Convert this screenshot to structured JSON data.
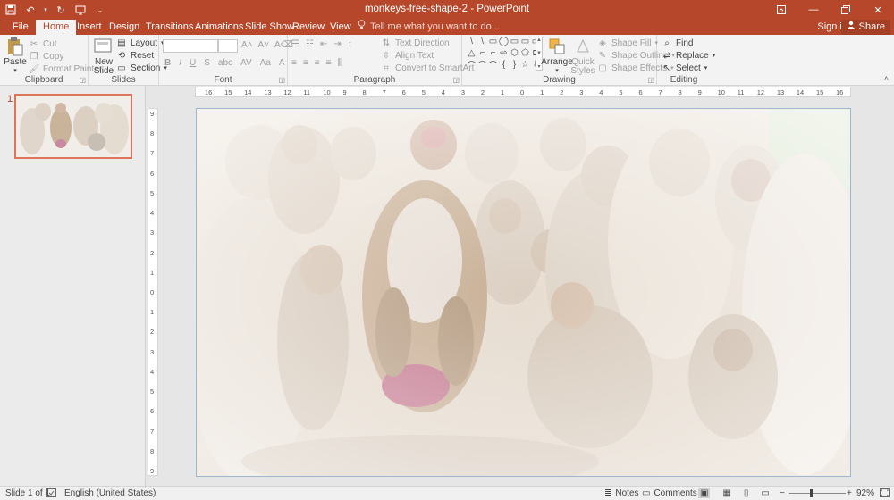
{
  "title_bar": {
    "document_title": "monkeys-free-shape-2 - PowerPoint",
    "qat_icons": [
      "save-icon",
      "undo-icon",
      "redo-icon",
      "start-from-beginning-icon",
      "customize-qat-icon"
    ],
    "window_controls": [
      "ribbon-display-icon",
      "minimize-icon",
      "restore-icon",
      "close-icon"
    ]
  },
  "tabs": [
    {
      "label": "File"
    },
    {
      "label": "Home"
    },
    {
      "label": "Insert"
    },
    {
      "label": "Design"
    },
    {
      "label": "Transitions"
    },
    {
      "label": "Animations"
    },
    {
      "label": "Slide Show"
    },
    {
      "label": "Review"
    },
    {
      "label": "View"
    }
  ],
  "active_tab": "Home",
  "tell_me": "Tell me what you want to do...",
  "sign_in": "Sign in",
  "share": "Share",
  "ribbon": {
    "clipboard": {
      "label": "Clipboard",
      "paste": "Paste",
      "cut": "Cut",
      "copy": "Copy",
      "format_painter": "Format Painter"
    },
    "slides": {
      "label": "Slides",
      "new_slide_line1": "New",
      "new_slide_line2": "Slide",
      "layout": "Layout",
      "reset": "Reset",
      "section": "Section"
    },
    "font": {
      "label": "Font",
      "buttons": [
        "B",
        "I",
        "U",
        "S",
        "abc",
        "AV",
        "Aa",
        "A"
      ]
    },
    "paragraph": {
      "label": "Paragraph",
      "text_direction": "Text Direction",
      "align_text": "Align Text",
      "convert_smartart": "Convert to SmartArt"
    },
    "drawing": {
      "label": "Drawing",
      "arrange": "Arrange",
      "quick_styles_line1": "Quick",
      "quick_styles_line2": "Styles",
      "shape_fill": "Shape Fill",
      "shape_outline": "Shape Outline",
      "shape_effects": "Shape Effects",
      "shapes": [
        "\\",
        "\\",
        "▭",
        "◯",
        "▭",
        "▭",
        "▭",
        "△",
        "⌐",
        "⌐",
        "⇨",
        "⬡",
        "⬠",
        "⊏",
        "⌒",
        "⌒",
        "⌒",
        "{",
        "}",
        "☆",
        "⇩"
      ]
    },
    "editing": {
      "label": "Editing",
      "find": "Find",
      "replace": "Replace",
      "select": "Select"
    }
  },
  "rulers": {
    "horizontal": [
      "16",
      "15",
      "14",
      "13",
      "12",
      "11",
      "10",
      "9",
      "8",
      "7",
      "6",
      "5",
      "4",
      "3",
      "2",
      "1",
      "0",
      "1",
      "2",
      "3",
      "4",
      "5",
      "6",
      "7",
      "8",
      "9",
      "10",
      "11",
      "12",
      "13",
      "14",
      "15",
      "16"
    ],
    "vertical": [
      "9",
      "8",
      "7",
      "6",
      "5",
      "4",
      "3",
      "2",
      "1",
      "0",
      "1",
      "2",
      "3",
      "4",
      "5",
      "6",
      "7",
      "8",
      "9"
    ]
  },
  "thumbnails": [
    {
      "number": "1"
    }
  ],
  "status_bar": {
    "slide_info": "Slide 1 of 1",
    "language": "English (United States)",
    "notes": "Notes",
    "comments": "Comments",
    "zoom": "92%"
  },
  "colors": {
    "accent": "#b7472a",
    "ribbon_bg": "#f3f3f3",
    "selection": "#e0745a"
  }
}
